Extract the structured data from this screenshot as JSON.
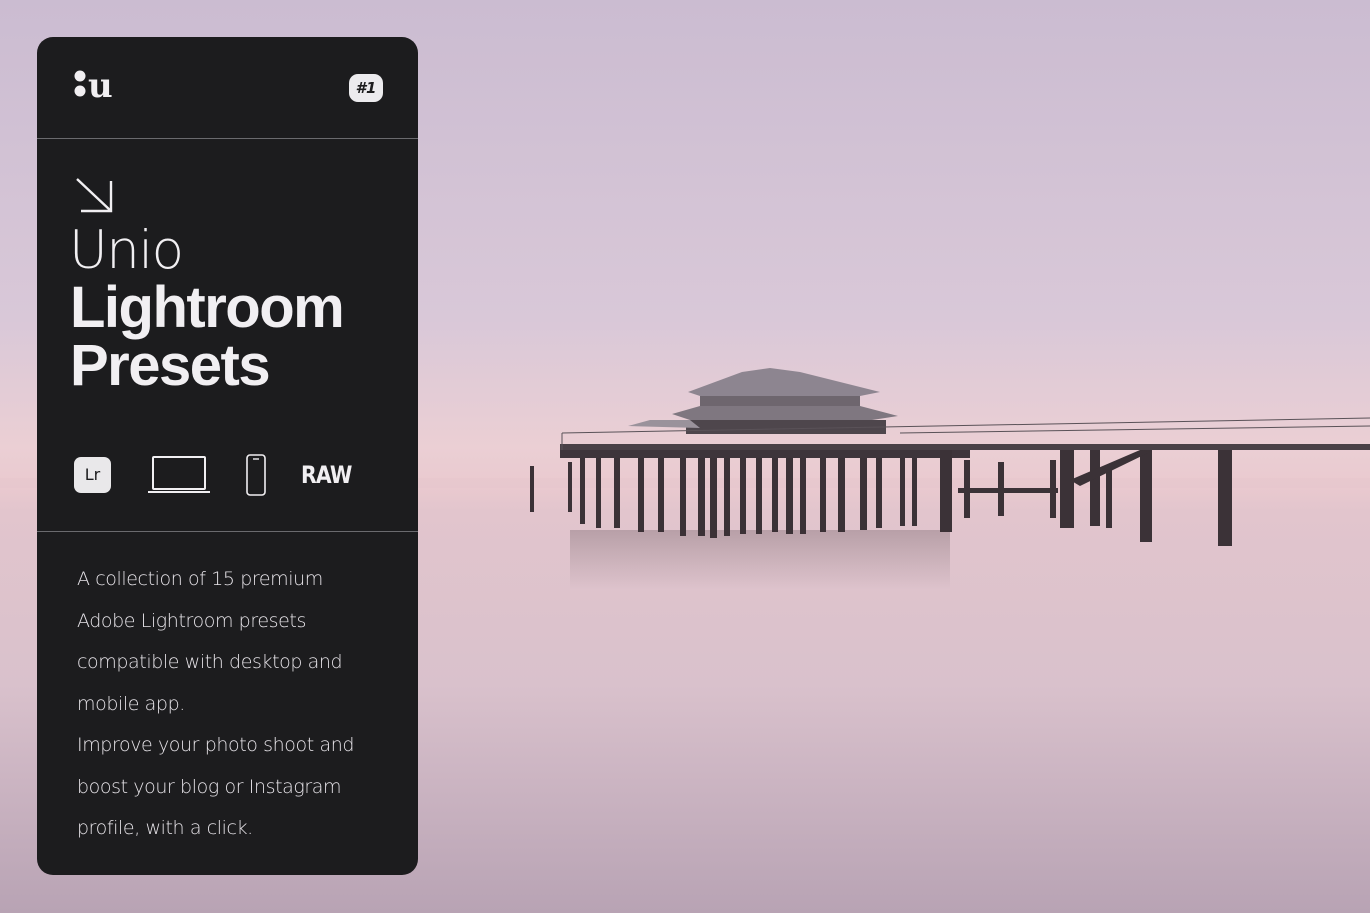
{
  "brand": {
    "logo_text": "u"
  },
  "badge": "#1",
  "title": {
    "light": "Unio",
    "bold_line1": "Lightroom",
    "bold_line2": "Presets"
  },
  "platforms": {
    "lr_label": "Lr",
    "raw_label": "RAW"
  },
  "description": {
    "lines": [
      "A collection of 15 premium",
      "Adobe Lightroom presets",
      "compatible with desktop and",
      "mobile app.",
      "Improve your photo shoot and",
      "boost your blog or Instagram",
      "profile, with a click."
    ]
  },
  "colors": {
    "card": "#1c1c1e",
    "sky_top": "#cdbfd3",
    "horizon": "#e3c4cc",
    "water": "#d7c1ca"
  },
  "icons": [
    "logo-mark",
    "arrow-down-right-icon",
    "laptop-icon",
    "phone-icon"
  ]
}
